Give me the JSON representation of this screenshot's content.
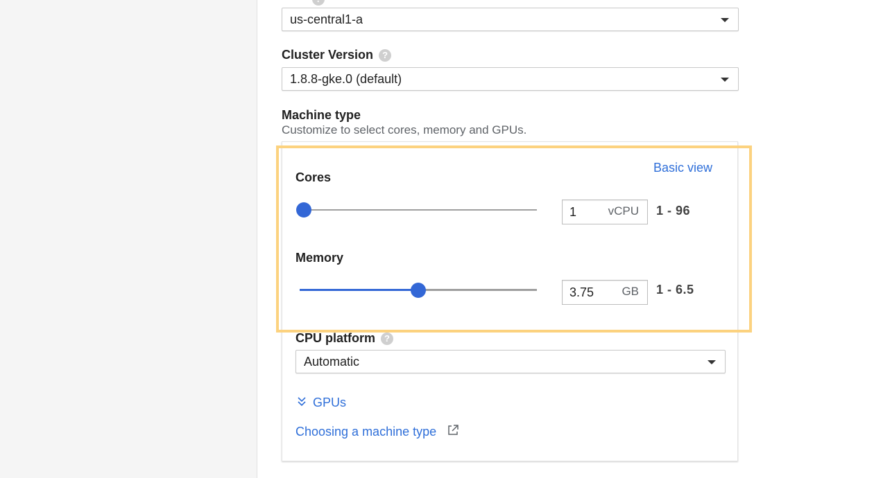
{
  "zone": {
    "value": "us-central1-a"
  },
  "cluster_version": {
    "label": "Cluster Version",
    "value": "1.8.8-gke.0 (default)"
  },
  "machine_type": {
    "label": "Machine type",
    "description": "Customize to select cores, memory and GPUs.",
    "basic_view_link": "Basic view",
    "cores": {
      "label": "Cores",
      "value": "1",
      "unit": "vCPU",
      "range": "1 - 96",
      "fraction": 0.0
    },
    "memory": {
      "label": "Memory",
      "value": "3.75",
      "unit": "GB",
      "range": "1 - 6.5",
      "fraction": 0.5
    },
    "cpu_platform": {
      "label": "CPU platform",
      "value": "Automatic"
    },
    "gpus_link": "GPUs",
    "choosing_link": "Choosing a machine type"
  },
  "colors": {
    "accent": "#3367d6",
    "link": "#2f6fd9",
    "highlight": "#fcd27f"
  },
  "icons": [
    "help-icon",
    "dropdown-caret-icon",
    "double-chevron-down-icon",
    "external-link-icon"
  ]
}
